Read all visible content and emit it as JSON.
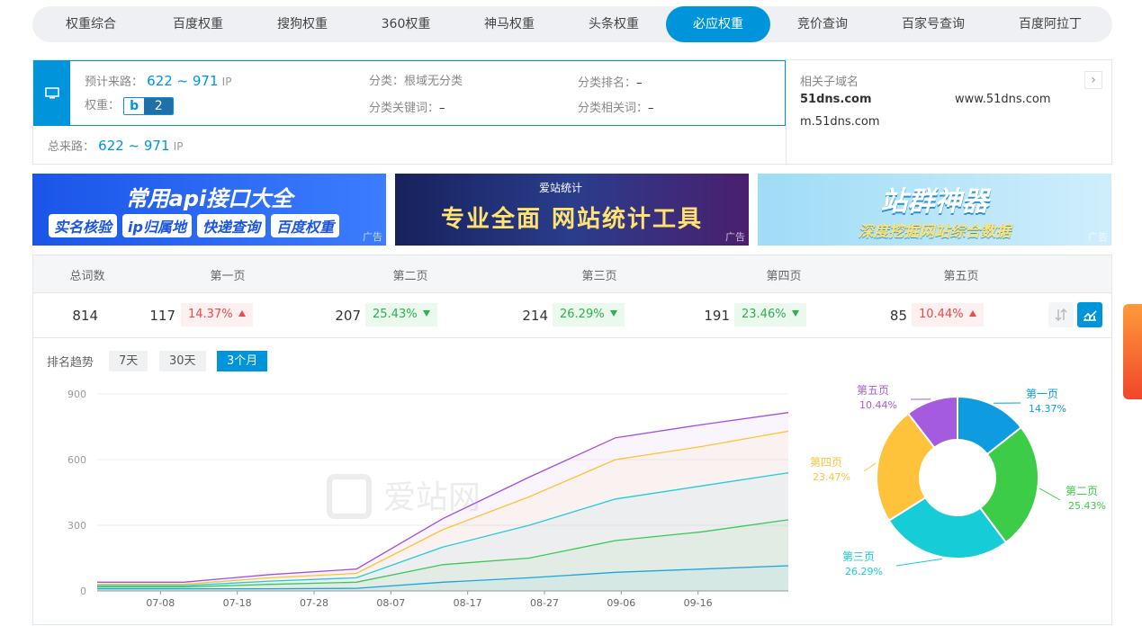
{
  "tabs": [
    {
      "label": "权重综合",
      "active": false
    },
    {
      "label": "百度权重",
      "active": false
    },
    {
      "label": "搜狗权重",
      "active": false
    },
    {
      "label": "360权重",
      "active": false
    },
    {
      "label": "神马权重",
      "active": false
    },
    {
      "label": "头条权重",
      "active": false
    },
    {
      "label": "必应权重",
      "active": true
    },
    {
      "label": "竞价查询",
      "active": false
    },
    {
      "label": "百家号查询",
      "active": false
    },
    {
      "label": "百度阿拉丁",
      "active": false
    }
  ],
  "info": {
    "traffic_label": "预计来路：",
    "traffic_value": "622 ~ 971",
    "traffic_unit": "IP",
    "weight_label": "权重：",
    "weight_icon": "bing-logo",
    "weight_value": "2",
    "category_label": "分类：",
    "category_value": "根域无分类",
    "category_rank_label": "分类排名：",
    "category_rank_value": "–",
    "category_keyword_label": "分类关键词：",
    "category_keyword_value": "–",
    "category_related_label": "分类相关词：",
    "category_related_value": "–",
    "total_label": "总来路：",
    "total_value": "622 ~ 971",
    "total_unit": "IP"
  },
  "subdomains": {
    "title": "相关子域名",
    "items": [
      "51dns.com",
      "www.51dns.com",
      "m.51dns.com"
    ]
  },
  "ads": [
    {
      "title": "常用api接口大全",
      "pills": [
        "实名核验",
        "ip归属地",
        "快递查询",
        "百度权重"
      ],
      "tag": "广告"
    },
    {
      "brand": "爱站统计",
      "title": "专业全面 网站统计工具",
      "tag": "广告"
    },
    {
      "title": "站群神器",
      "subtitle": "深度挖掘网站综合数据",
      "tag": "广告"
    }
  ],
  "stats": {
    "headers": [
      "总词数",
      "第一页",
      "第二页",
      "第三页",
      "第四页",
      "第五页"
    ],
    "total": "814",
    "pages": [
      {
        "count": "117",
        "pct": "14.37%",
        "dir": "up"
      },
      {
        "count": "207",
        "pct": "25.43%",
        "dir": "down"
      },
      {
        "count": "214",
        "pct": "26.29%",
        "dir": "down"
      },
      {
        "count": "191",
        "pct": "23.46%",
        "dir": "down"
      },
      {
        "count": "85",
        "pct": "10.44%",
        "dir": "up"
      }
    ]
  },
  "trend": {
    "label": "排名趋势",
    "ranges": [
      {
        "label": "7天",
        "active": false
      },
      {
        "label": "30天",
        "active": false
      },
      {
        "label": "3个月",
        "active": true
      }
    ],
    "watermark": "爱站网"
  },
  "chart_data": [
    {
      "type": "area",
      "x": [
        "07-08",
        "07-18",
        "07-28",
        "08-07",
        "08-17",
        "08-27",
        "09-06",
        "09-16"
      ],
      "yticks": [
        0,
        300,
        600,
        900
      ],
      "ylim": [
        0,
        900
      ],
      "series": [
        {
          "name": "第一页",
          "color": "#1aa5e0",
          "values": [
            10,
            10,
            10,
            12,
            40,
            60,
            85,
            100,
            115
          ]
        },
        {
          "name": "第二页",
          "color": "#39c75a",
          "values": [
            18,
            18,
            30,
            40,
            120,
            150,
            230,
            270,
            325
          ]
        },
        {
          "name": "第三页",
          "color": "#22ccd6",
          "values": [
            24,
            24,
            45,
            60,
            200,
            300,
            420,
            480,
            540
          ]
        },
        {
          "name": "第四页",
          "color": "#ffc233",
          "values": [
            30,
            30,
            60,
            80,
            280,
            430,
            600,
            660,
            730
          ]
        },
        {
          "name": "第五页",
          "color": "#a44ee0",
          "values": [
            40,
            40,
            75,
            100,
            330,
            520,
            700,
            760,
            815
          ]
        }
      ]
    },
    {
      "type": "pie",
      "labels": [
        "第一页",
        "第二页",
        "第三页",
        "第四页",
        "第五页"
      ],
      "values": [
        14.37,
        25.43,
        26.29,
        23.47,
        10.44
      ],
      "value_labels": [
        "14.37%",
        "25.43%",
        "26.29%",
        "23.47%",
        "10.44%"
      ],
      "colors": [
        "#0f9be0",
        "#3ccc47",
        "#16ccd6",
        "#ffc33b",
        "#a45be0"
      ]
    }
  ]
}
